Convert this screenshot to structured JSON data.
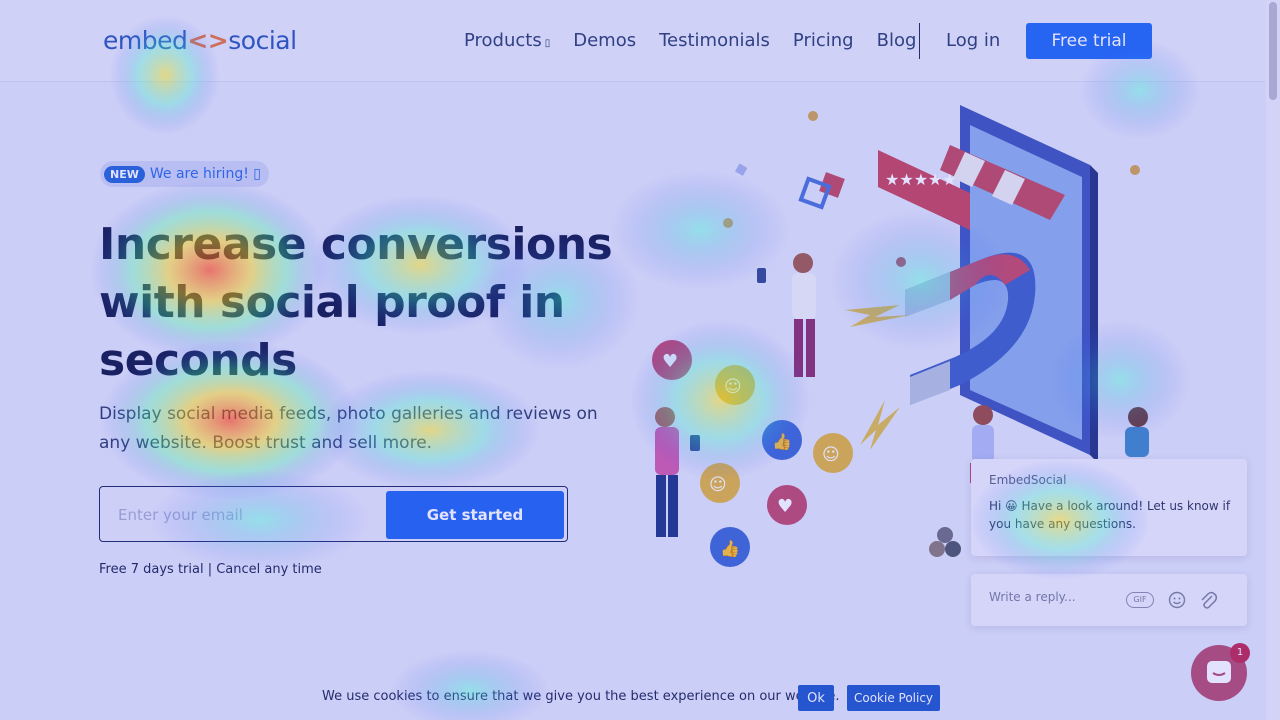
{
  "header": {
    "logo": {
      "left": "embed",
      "mark": "<>",
      "right": "social"
    },
    "nav": [
      {
        "label": "Products",
        "caret": "▯"
      },
      {
        "label": "Demos"
      },
      {
        "label": "Testimonials"
      },
      {
        "label": "Pricing"
      },
      {
        "label": "Blog"
      }
    ],
    "login_label": "Log in",
    "free_trial_label": "Free trial"
  },
  "hero": {
    "badge": "NEW",
    "hiring_text": "We are hiring! ▯",
    "headline_lines": [
      "Increase conversions",
      "with social proof in",
      "seconds"
    ],
    "subline": "Display social media feeds, photo galleries and reviews on any website. Boost trust and sell more.",
    "email_placeholder": "Enter your email",
    "cta_label": "Get started",
    "trial_note": "Free 7 days trial | Cancel any time"
  },
  "chat": {
    "sender": "EmbedSocial",
    "message": "Hi 😀 Have a look around! Let us know if you have any questions.",
    "reply_placeholder": "Write a reply...",
    "gif_label": "GIF",
    "unread_count": "1"
  },
  "cookie": {
    "text": "We use cookies to ensure that we give you the best experience on our website.",
    "ok_label": "Ok",
    "policy_label": "Cookie Policy"
  },
  "colors": {
    "brand_blue": "#1f66ec",
    "headline": "#101a45",
    "chat_launcher": "#b74d6e"
  }
}
